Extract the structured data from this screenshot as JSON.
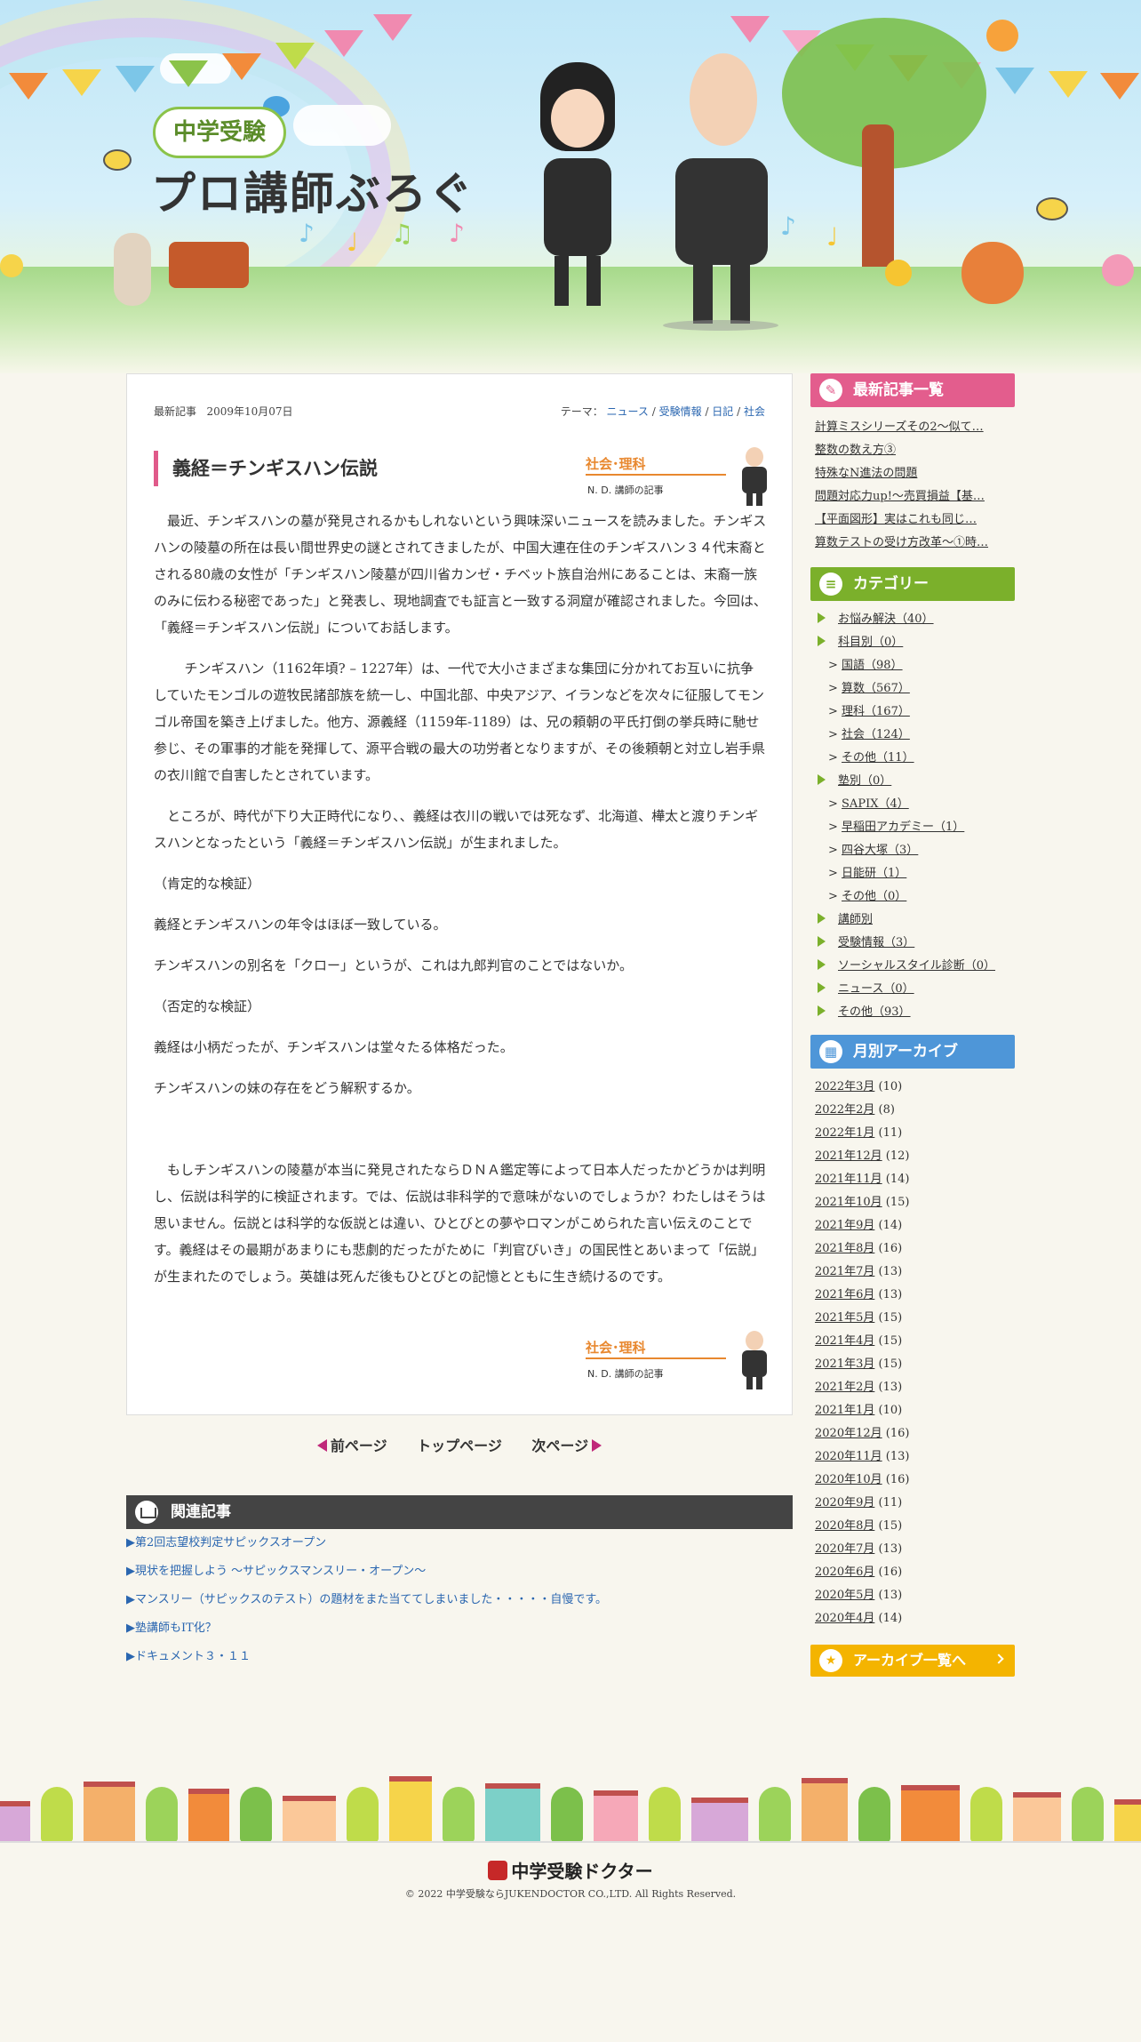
{
  "header": {
    "logo_small": "中学受験",
    "logo_main": "プロ講師ぶろぐ"
  },
  "article": {
    "meta_label": "最新記事",
    "date": "2009年10月07日",
    "theme_label": "テーマ：",
    "themes": [
      "ニュース",
      "受験情報",
      "日記",
      "社会"
    ],
    "theme_sep": " / ",
    "title": "義経＝チンギスハン伝説",
    "author_subject": "社会･理科",
    "author_name": "N. D. 講師の記事",
    "paragraphs": [
      "最近、チンギスハンの墓が発見されるかもしれないという興味深いニュースを読みました。チンギスハンの陵墓の所在は長い間世界史の謎とされてきましたが、中国大連在住のチンギスハン３４代末裔とされる80歳の女性が「チンギスハン陵墓が四川省カンゼ・チベット族自治州にあることは、末裔一族のみに伝わる秘密であった」と発表し、現地調査でも証言と一致する洞窟が確認されました。今回は、「義経＝チンギスハン伝説」についてお話します。",
      "チンギスハン（1162年頃? – 1227年）は、一代で大小さまざまな集団に分かれてお互いに抗争していたモンゴルの遊牧民諸部族を統一し、中国北部、中央アジア、イランなどを次々に征服してモンゴル帝国を築き上げました。他方、源義経（1159年-1189）は、兄の頼朝の平氏打倒の挙兵時に馳せ参じ、その軍事的才能を発揮して、源平合戦の最大の功労者となりますが、その後頼朝と対立し岩手県の衣川館で自害したとされています。",
      "ところが、時代が下り大正時代になり、、義経は衣川の戦いでは死なず、北海道、樺太と渡りチンギスハンとなったという「義経＝チンギスハン伝説」が生まれました。",
      "（肯定的な検証）",
      "義経とチンギスハンの年令はほぼ一致している。",
      "チンギスハンの別名を「クロー」というが、これは九郎判官のことではないか。",
      "（否定的な検証）",
      "義経は小柄だったが、チンギスハンは堂々たる体格だった。",
      "チンギスハンの妹の存在をどう解釈するか。",
      "もしチンギスハンの陵墓が本当に発見されたならＤＮＡ鑑定等によって日本人だったかどうかは判明し、伝説は科学的に検証されます。では、伝説は非科学的で意味がないのでしょうか？わたしはそうは思いません。伝説とは科学的な仮説とは違い、ひとびとの夢やロマンがこめられた言い伝えのことです。義経はその最期があまりにも悲劇的だったがために「判官びいき」の国民性とあいまって「伝説」が生まれたのでしょう。英雄は死んだ後もひとびとの記憶とともに生き続けるのです。"
    ]
  },
  "pagenav": {
    "prev": "前ページ",
    "top": "トップページ",
    "next": "次ページ"
  },
  "related": {
    "heading": "関連記事",
    "items": [
      "▶第2回志望校判定サピックスオープン",
      "▶現状を把握しよう ～サピックスマンスリー・オープン～",
      "▶マンスリー（サピックスのテスト）の題材をまた当ててしまいました・・・・・自慢です。",
      "▶塾講師もIT化？",
      "▶ドキュメント３・１１"
    ]
  },
  "sidebar": {
    "recent_heading": "最新記事一覧",
    "recent": [
      "計算ミスシリーズその2～似て…",
      "整数の数え方③",
      "特殊なN進法の問題",
      "問題対応力up!～売買損益【基…",
      "【平面図形】実はこれも同じ…",
      "算数テストの受け方改革～①時…"
    ],
    "category_heading": "カテゴリー",
    "categories": [
      {
        "level": 1,
        "label": "お悩み解決（40）"
      },
      {
        "level": 1,
        "label": "科目別（0）"
      },
      {
        "level": 2,
        "label": "国語（98）"
      },
      {
        "level": 2,
        "label": "算数（567）"
      },
      {
        "level": 2,
        "label": "理科（167）"
      },
      {
        "level": 2,
        "label": "社会（124）"
      },
      {
        "level": 2,
        "label": "その他（11）"
      },
      {
        "level": 1,
        "label": "塾別（0）"
      },
      {
        "level": 2,
        "label": "SAPIX（4）"
      },
      {
        "level": 2,
        "label": "早稲田アカデミー（1）"
      },
      {
        "level": 2,
        "label": "四谷大塚（3）"
      },
      {
        "level": 2,
        "label": "日能研（1）"
      },
      {
        "level": 2,
        "label": "その他（0）"
      },
      {
        "level": 1,
        "label": "講師別"
      },
      {
        "level": 1,
        "label": "受験情報（3）"
      },
      {
        "level": 1,
        "label": "ソーシャルスタイル診断（0）"
      },
      {
        "level": 1,
        "label": "ニュース（0）"
      },
      {
        "level": 1,
        "label": "その他（93）"
      }
    ],
    "archive_heading": "月別アーカイブ",
    "months": [
      {
        "label": "2022年3月",
        "count": "(10)"
      },
      {
        "label": "2022年2月",
        "count": "(8)"
      },
      {
        "label": "2022年1月",
        "count": "(11)"
      },
      {
        "label": "2021年12月",
        "count": "(12)"
      },
      {
        "label": "2021年11月",
        "count": "(14)"
      },
      {
        "label": "2021年10月",
        "count": "(15)"
      },
      {
        "label": "2021年9月",
        "count": "(14)"
      },
      {
        "label": "2021年8月",
        "count": "(16)"
      },
      {
        "label": "2021年7月",
        "count": "(13)"
      },
      {
        "label": "2021年6月",
        "count": "(13)"
      },
      {
        "label": "2021年5月",
        "count": "(15)"
      },
      {
        "label": "2021年4月",
        "count": "(15)"
      },
      {
        "label": "2021年3月",
        "count": "(15)"
      },
      {
        "label": "2021年2月",
        "count": "(13)"
      },
      {
        "label": "2021年1月",
        "count": "(10)"
      },
      {
        "label": "2020年12月",
        "count": "(16)"
      },
      {
        "label": "2020年11月",
        "count": "(13)"
      },
      {
        "label": "2020年10月",
        "count": "(16)"
      },
      {
        "label": "2020年9月",
        "count": "(11)"
      },
      {
        "label": "2020年8月",
        "count": "(15)"
      },
      {
        "label": "2020年7月",
        "count": "(13)"
      },
      {
        "label": "2020年6月",
        "count": "(16)"
      },
      {
        "label": "2020年5月",
        "count": "(13)"
      },
      {
        "label": "2020年4月",
        "count": "(14)"
      }
    ],
    "archive_button": "アーカイブ一覧へ"
  },
  "footer": {
    "logo": "中学受験ドクター",
    "copyright": "© 2022 中学受験ならJUKENDOCTOR CO.,LTD. All Rights Reserved."
  },
  "colors": {
    "accent_pink": "#e35d8d",
    "accent_green": "#7bb02b",
    "accent_blue": "#4e96d8",
    "accent_orange": "#e8882f",
    "archive_yellow": "#f4b400",
    "link_blue": "#2a66b0"
  },
  "icons": [
    "pencil-icon",
    "memo-icon",
    "calendar-icon",
    "star-icon",
    "book-icon"
  ]
}
